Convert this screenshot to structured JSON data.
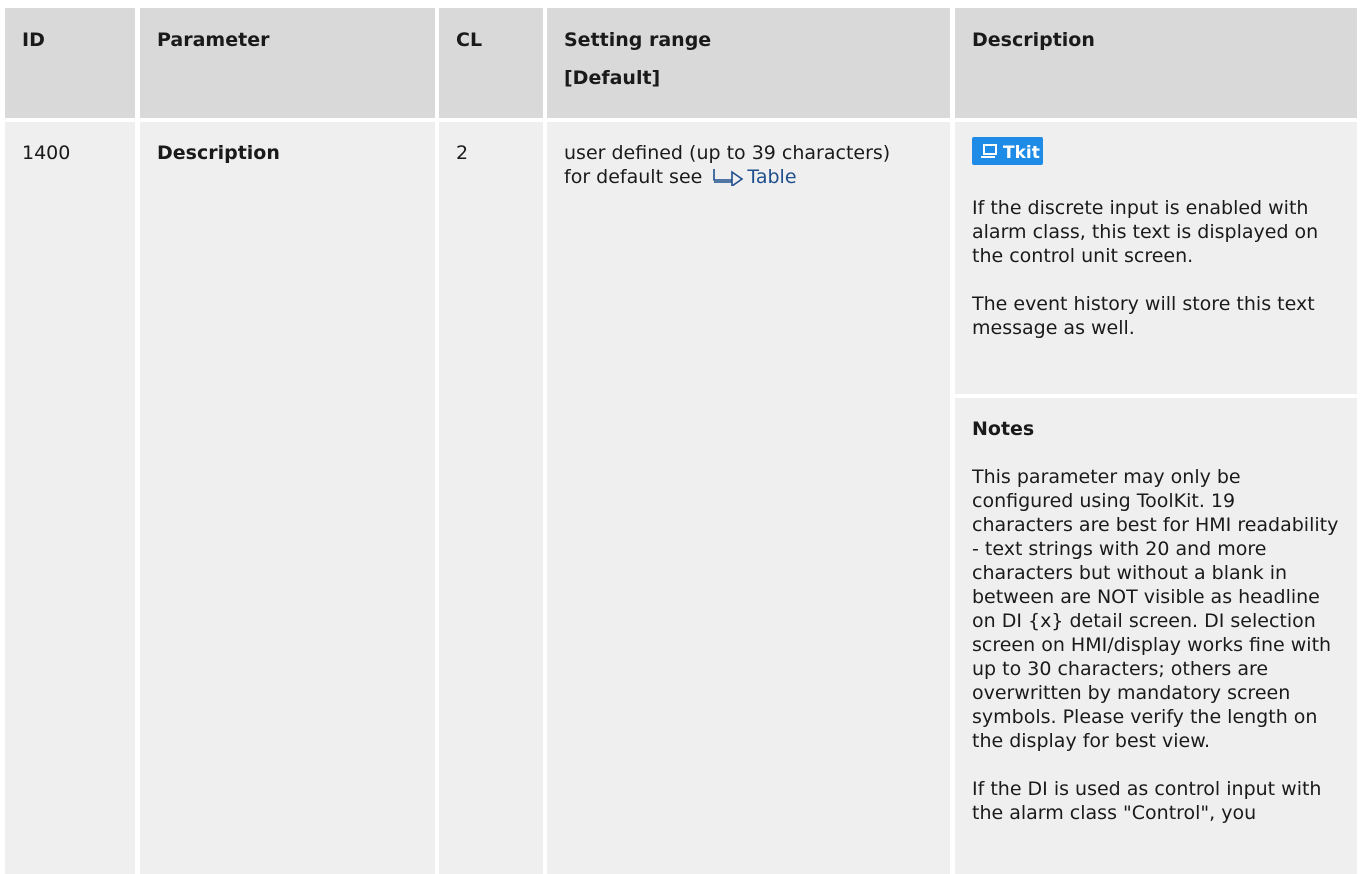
{
  "table": {
    "headers": {
      "id": "ID",
      "parameter": "Parameter",
      "cl": "CL",
      "setting_range_line1": "Setting range",
      "setting_range_line2": "[Default]",
      "description": "Description"
    },
    "row": {
      "id": "1400",
      "parameter": "Description",
      "cl": "2",
      "setting_range_line1": "user defined (up to 39 characters)",
      "setting_range_prefix": "for default see",
      "setting_range_link": "Table",
      "tool_icon_label": "Tkit",
      "description_paragraphs": [
        "If the discrete input is enabled with alarm class, this text is displayed on the control unit screen.",
        "The event history will store this text message as well."
      ],
      "notes_title": "Notes",
      "notes_paragraphs": [
        "This parameter may only be configured using ToolKit. 19 characters are best for HMI readability - text strings with 20 and more characters but without a blank in between are NOT visible as headline on DI {x} detail screen. DI selection screen on HMI/display works fine with up to 30 characters; others are overwritten by mandatory screen symbols. Please verify the length on the display for best view.",
        "If the DI is used as control input with the alarm class \"Control\", you"
      ]
    }
  },
  "colors": {
    "header_bg": "#d9d9d9",
    "body_bg": "#efefef",
    "link": "#1f4e8c",
    "tool_icon_bg": "#1e8ce6"
  },
  "icons": {
    "cross_reference": "arrow-right-icon",
    "toolkit": "toolkit-badge-icon"
  }
}
